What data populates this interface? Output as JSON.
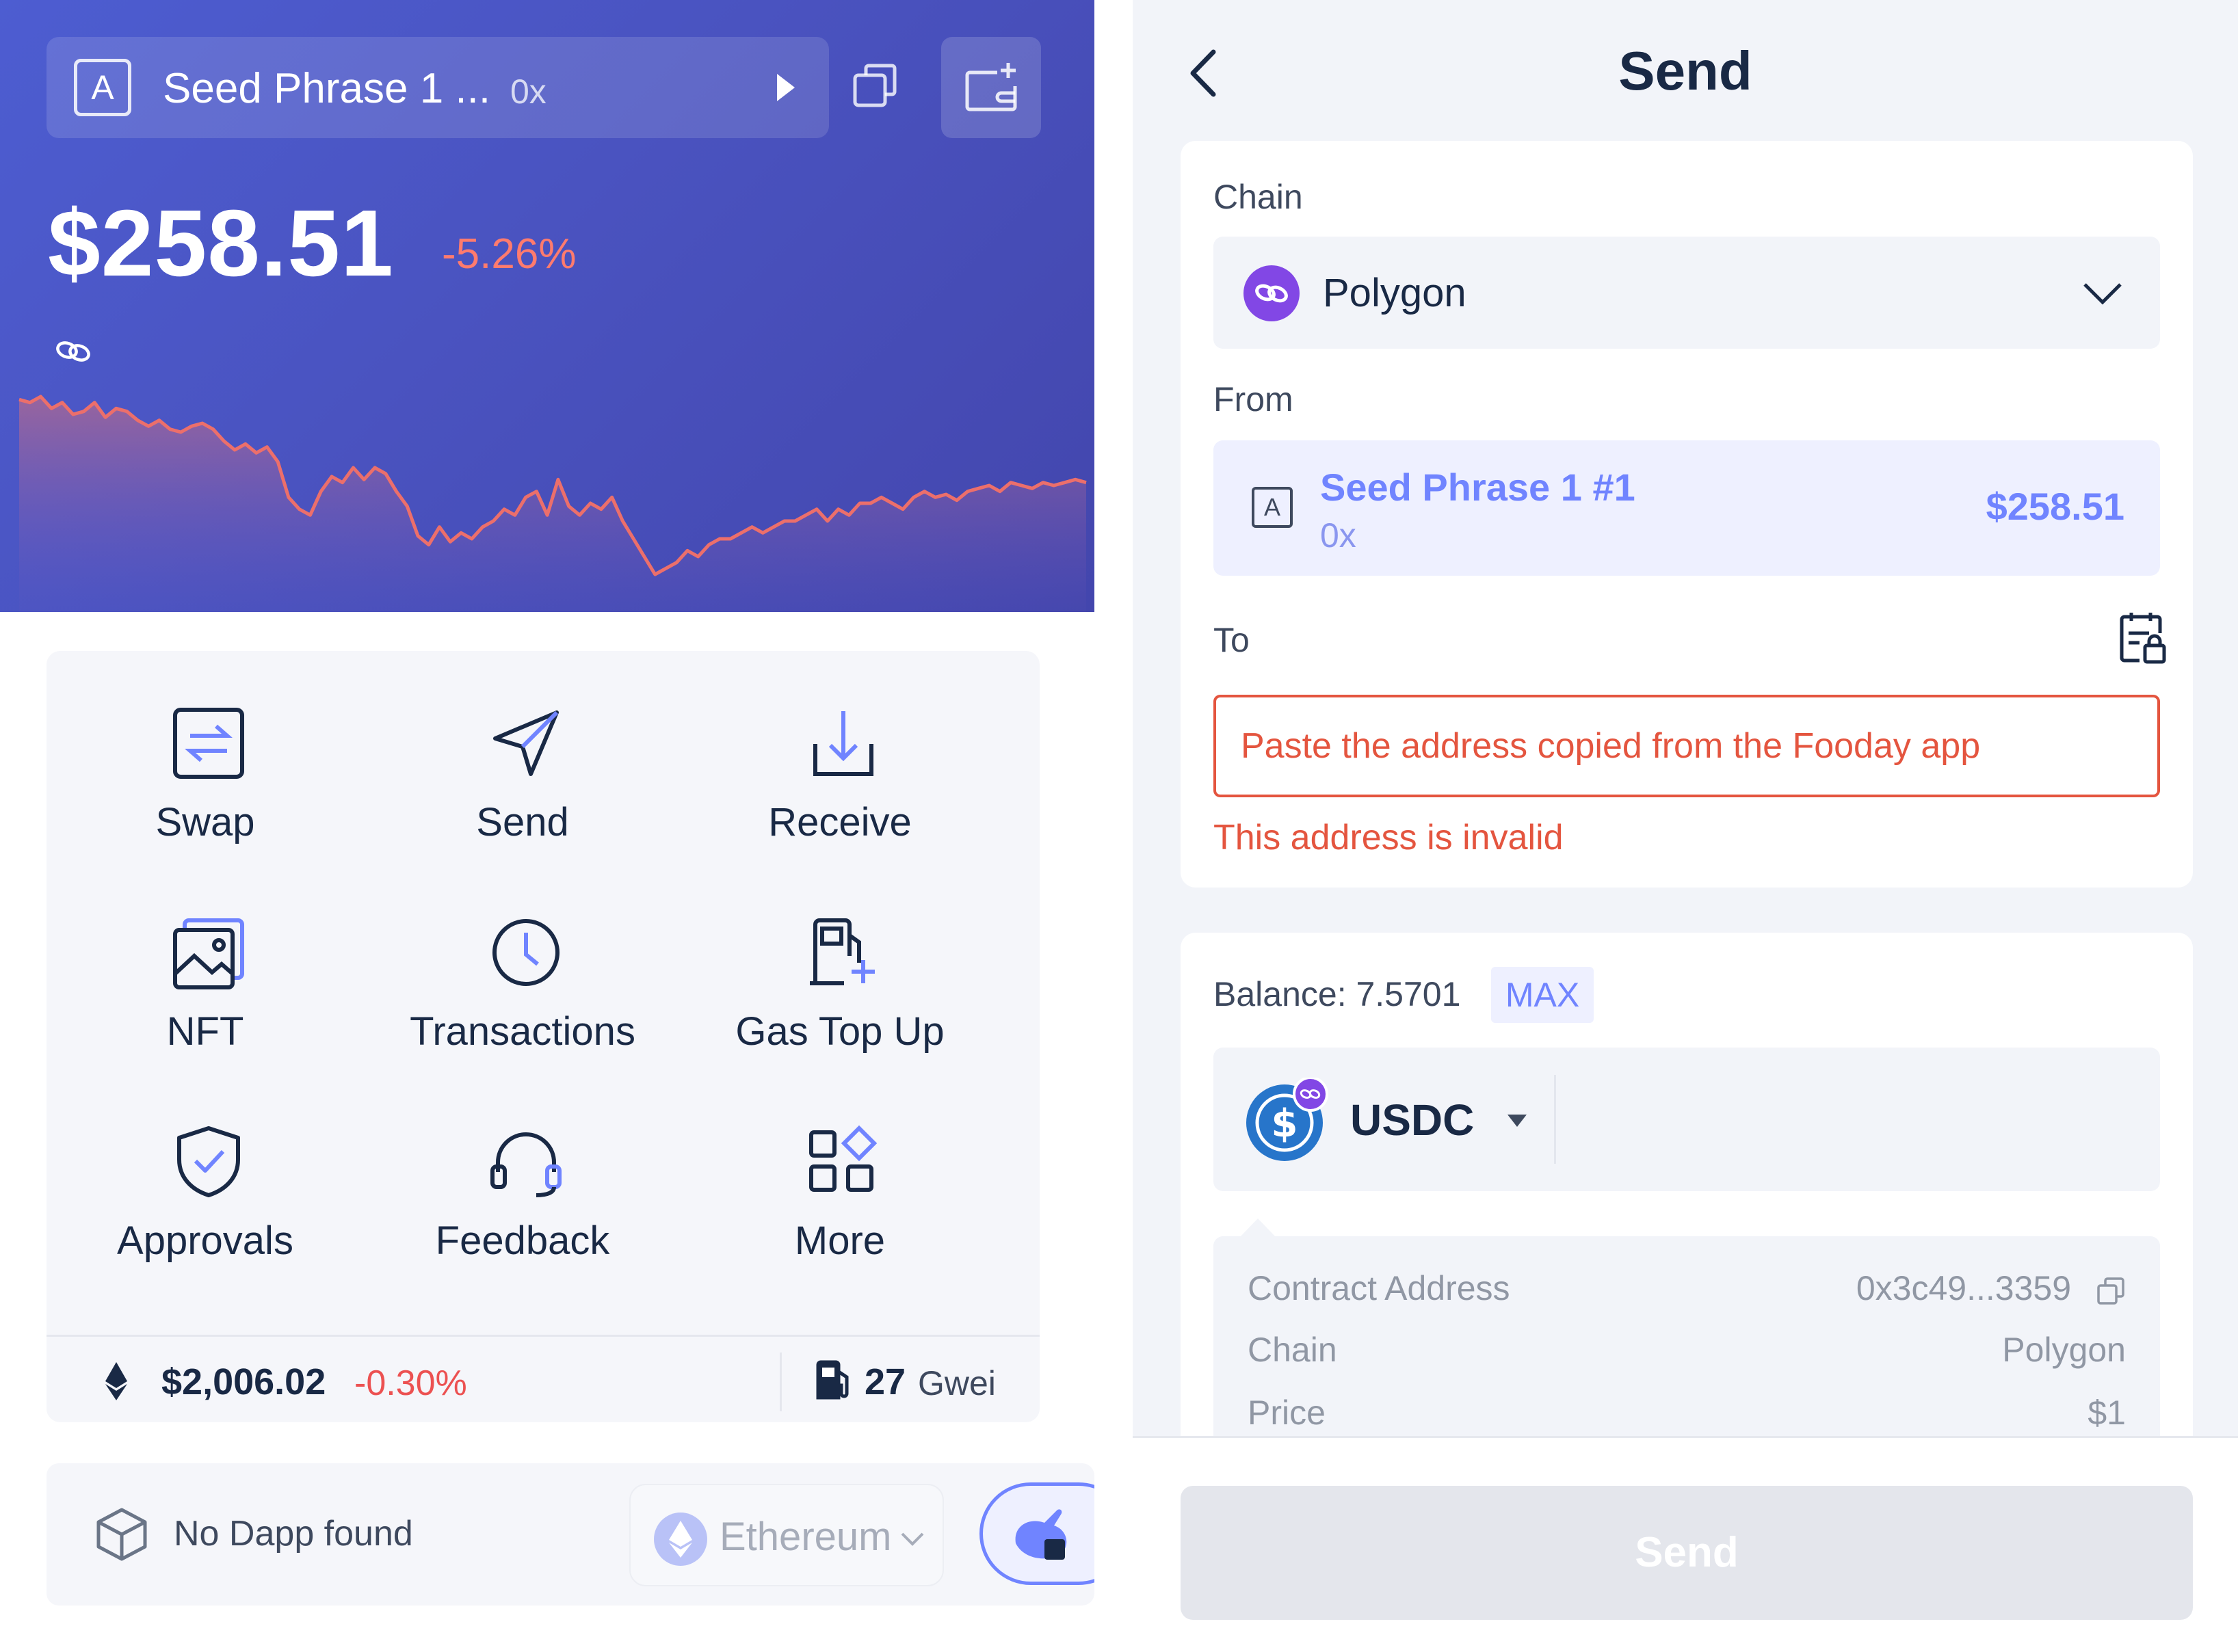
{
  "wallet": {
    "account_letter": "A",
    "account_name": "Seed Phrase 1 ...",
    "account_address": "0x",
    "total_balance": "$258.51",
    "balance_change": "-5.26%"
  },
  "actions": [
    {
      "label": "Swap",
      "icon": "swap-icon"
    },
    {
      "label": "Send",
      "icon": "send-icon"
    },
    {
      "label": "Receive",
      "icon": "receive-icon"
    },
    {
      "label": "NFT",
      "icon": "nft-icon"
    },
    {
      "label": "Transactions",
      "icon": "clock-icon"
    },
    {
      "label": "Gas Top Up",
      "icon": "gas-top-up-icon"
    },
    {
      "label": "Approvals",
      "icon": "shield-icon"
    },
    {
      "label": "Feedback",
      "icon": "headset-icon"
    },
    {
      "label": "More",
      "icon": "grid-icon"
    }
  ],
  "market": {
    "eth_price": "$2,006.02",
    "eth_change": "-0.30%",
    "gas_value": "27",
    "gas_unit": "Gwei"
  },
  "dapp": {
    "status": "No Dapp found",
    "chain": "Ethereum"
  },
  "send": {
    "title": "Send",
    "chain_label": "Chain",
    "chain_value": "Polygon",
    "from_label": "From",
    "from_letter": "A",
    "from_name": "Seed Phrase 1 #1",
    "from_address": "0x",
    "from_balance": "$258.51",
    "to_label": "To",
    "to_placeholder": "Paste the address copied from the Fooday app",
    "to_error": "This address is invalid",
    "balance_label": "Balance: 7.5701",
    "max_label": "MAX",
    "token": "USDC",
    "token_info": [
      {
        "key": "Contract Address",
        "value": "0x3c49...3359"
      },
      {
        "key": "Chain",
        "value": "Polygon"
      },
      {
        "key": "Price",
        "value": "$1"
      }
    ],
    "submit_label": "Send"
  },
  "colors": {
    "brand": "#7084ff",
    "hero_gradient_start": "#4d5dd1",
    "hero_gradient_end": "#4346ad",
    "negative": "#ec5151",
    "error": "#e4553f",
    "polygon": "#8247e5",
    "usdc": "#2775ca"
  },
  "chart_data": {
    "type": "area",
    "series": [
      {
        "values": [
          61,
          60,
          62,
          58,
          60,
          56,
          57,
          60,
          55,
          58,
          57,
          54,
          52,
          54,
          51,
          50,
          52,
          53,
          51,
          47,
          44,
          46,
          43,
          45,
          40,
          28,
          24,
          22,
          30,
          35,
          33,
          38,
          34,
          38,
          36,
          30,
          25,
          15,
          12,
          18,
          13,
          16,
          14,
          18,
          20,
          24,
          22,
          28,
          30,
          22,
          34,
          25,
          22,
          26,
          24,
          28,
          20,
          14,
          8,
          2,
          4,
          6,
          10,
          8,
          12,
          14,
          14,
          16,
          18,
          16,
          18,
          20,
          20,
          22,
          24,
          20,
          24,
          22,
          26,
          26,
          28,
          26,
          24,
          28,
          30,
          28,
          29,
          27,
          30,
          31,
          32,
          30,
          33,
          32,
          31,
          33,
          32,
          33,
          34,
          33
        ]
      }
    ],
    "trend": "down"
  }
}
